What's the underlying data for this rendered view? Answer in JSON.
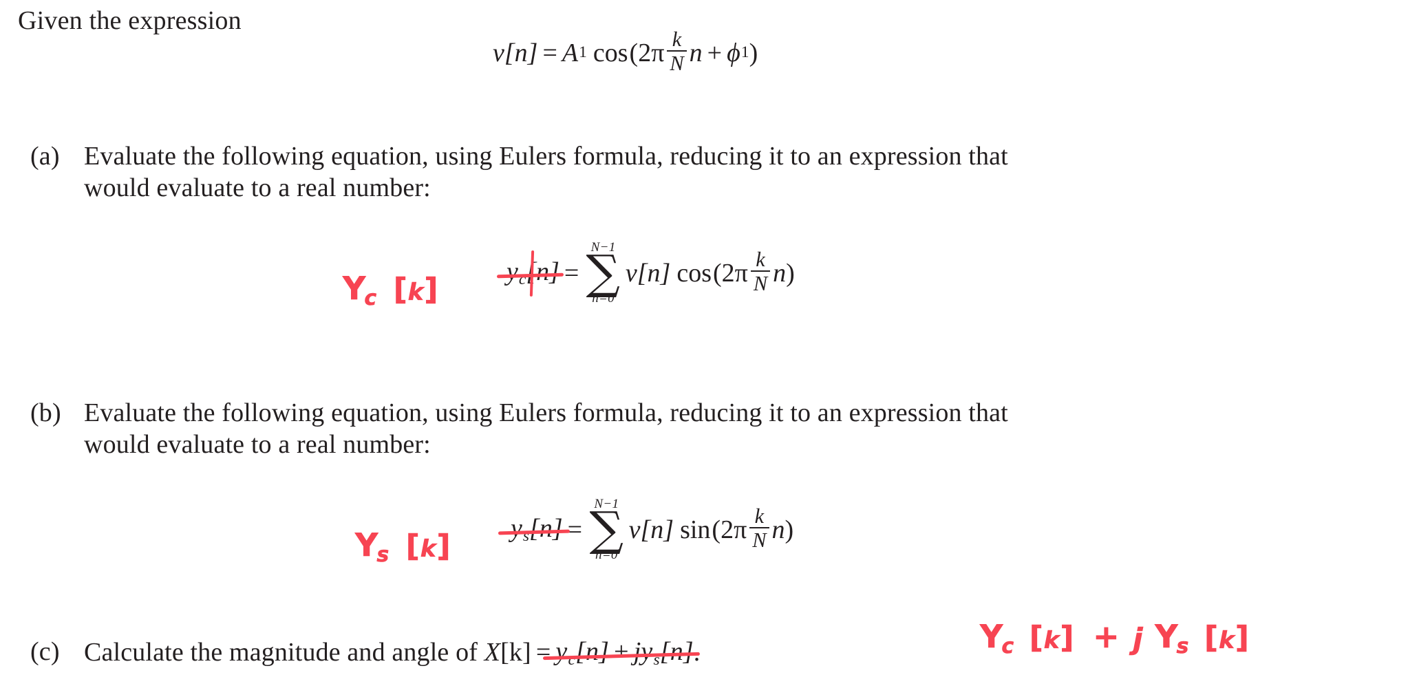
{
  "document": {
    "intro": "Given the expression",
    "pen_color": "#f74452",
    "ink_color": "#231f20"
  },
  "main_equation": {
    "lhs": "v[n]",
    "equals": "=",
    "amplitude": "A",
    "amplitude_sub": "1",
    "function": "cos",
    "open_paren": "(",
    "two_pi": "2π",
    "frac_num": "k",
    "frac_den": "N",
    "variable": "n",
    "plus": "+",
    "phase": "ϕ",
    "phase_sub": "1",
    "close_paren": ")"
  },
  "items": [
    {
      "marker": "(a)",
      "line1": "Evaluate the following equation, using Eulers formula, reducing it to an expression that",
      "line2": "would evaluate to a real number:",
      "equation": {
        "struck_lhs": "y",
        "struck_lhs_sub": "c",
        "struck_lhs_idx": "[n]",
        "equals": "=",
        "sum_upper": "N−1",
        "sum_symbol": "∑",
        "sum_lower": "n=0",
        "term": "v[n]",
        "function": "cos",
        "open_paren": "(",
        "two_pi": "2π",
        "frac_num": "k",
        "frac_den": "N",
        "variable": "n",
        "close_paren": ")"
      },
      "annotation": {
        "letter": "Y",
        "sub": "c",
        "open_bracket": "[",
        "index": "k",
        "close_bracket": "]"
      }
    },
    {
      "marker": "(b)",
      "line1": "Evaluate the following equation, using Eulers formula, reducing it to an expression that",
      "line2": "would evaluate to a real number:",
      "equation": {
        "struck_lhs": "y",
        "struck_lhs_sub": "s",
        "struck_lhs_idx": "[n]",
        "equals": "=",
        "sum_upper": "N−1",
        "sum_symbol": "∑",
        "sum_lower": "n=0",
        "term": "v[n]",
        "function": "sin",
        "open_paren": "(",
        "two_pi": "2π",
        "frac_num": "k",
        "frac_den": "N",
        "variable": "n",
        "close_paren": ")"
      },
      "annotation": {
        "letter": "Y",
        "sub": "s",
        "open_bracket": "[",
        "index": "k",
        "close_bracket": "]"
      }
    },
    {
      "marker": "(c)",
      "line1_pre": "Calculate the magnitude and angle of ",
      "inline_math": {
        "lhs": "X",
        "lhs_idx": "[k]",
        "equals": "=",
        "struck_a": "y",
        "struck_a_sub": "c",
        "struck_a_idx": "[n]",
        "struck_plus": "+",
        "struck_j": "j",
        "struck_b": "y",
        "struck_b_sub": "s",
        "struck_b_idx": "[n]",
        "period": "."
      },
      "annotation": {
        "letter_1": "Y",
        "sub_1": "c",
        "open_bracket_1": "[",
        "index_1": "k",
        "close_bracket_1": "]",
        "plus": "+",
        "imag": "j",
        "letter_2": "Y",
        "sub_2": "s",
        "open_bracket_2": "[",
        "index_2": "k",
        "close_bracket_2": "]"
      }
    }
  ]
}
